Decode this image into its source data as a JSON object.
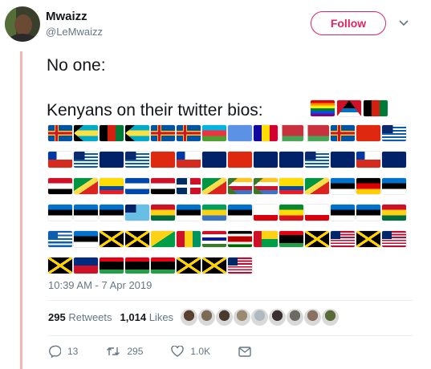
{
  "tweet": {
    "author_name": "Mwaizz",
    "author_handle": "@LeMwaizz",
    "follow_label": "Follow",
    "line1": "No one:",
    "line2": "Kenyans on their twitter bios:",
    "timestamp": "10:39 AM - 7 Apr 2019"
  },
  "stats": {
    "retweets_count": "295",
    "retweets_label": "Retweets",
    "likes_count": "1,014",
    "likes_label": "Likes"
  },
  "actions": {
    "replies": "13",
    "retweets": "295",
    "likes": "1.0K"
  },
  "colors": {
    "follow": "#e0245e",
    "thread_line": "#f5b5b5",
    "muted": "#657786"
  },
  "inline_flags": [
    "rainbow-flag",
    "antigua-flag",
    "afghanistan-flag"
  ],
  "flag_rows": [
    [
      "aland",
      "bahamas",
      "afghanistan",
      "bahamas",
      "aland",
      "aland",
      "azerbaijan",
      "united-nations",
      "andorra",
      "belarus",
      "belarus",
      "aland",
      "china"
    ],
    [
      "british-indian-ocean",
      "chile",
      "british-indian-ocean",
      "virgin-islands",
      "british-indian-ocean",
      "china",
      "chile",
      "virgin-islands",
      "china",
      "virgin-islands",
      "cook-islands",
      "british-indian-ocean",
      "virgin-islands"
    ],
    [
      "chile",
      "virgin-islands",
      "egypt",
      "congo",
      "ecuador",
      "el-salvador",
      "egypt",
      "dominican-republic",
      "congo",
      "comoros",
      "comoros",
      "ecuador",
      "congo"
    ],
    [
      "estonia",
      "germany",
      "estonia",
      "estonia",
      "estonia",
      "estonia",
      "fiji",
      "ghana",
      "estonia",
      "gabon",
      "estonia",
      "gibraltar",
      "ethiopia"
    ],
    [
      "gibraltar",
      "estonia",
      "estonia",
      "ghana",
      "greece",
      "estonia",
      "jamaica",
      "jamaica",
      "guyana",
      "guinea",
      "gambia",
      "kenya",
      "guinea-bissau"
    ],
    [
      "libya",
      "jamaica",
      "liberia",
      "jamaica",
      "liberia",
      "jamaica",
      "liechtenstein",
      "libya",
      "libya",
      "libya",
      "jamaica",
      "jamaica",
      "liberia"
    ]
  ],
  "liker_avatars": [
    "liker-1",
    "liker-2",
    "liker-3",
    "liker-4",
    "liker-5",
    "liker-6",
    "liker-7",
    "liker-8",
    "liker-9"
  ]
}
